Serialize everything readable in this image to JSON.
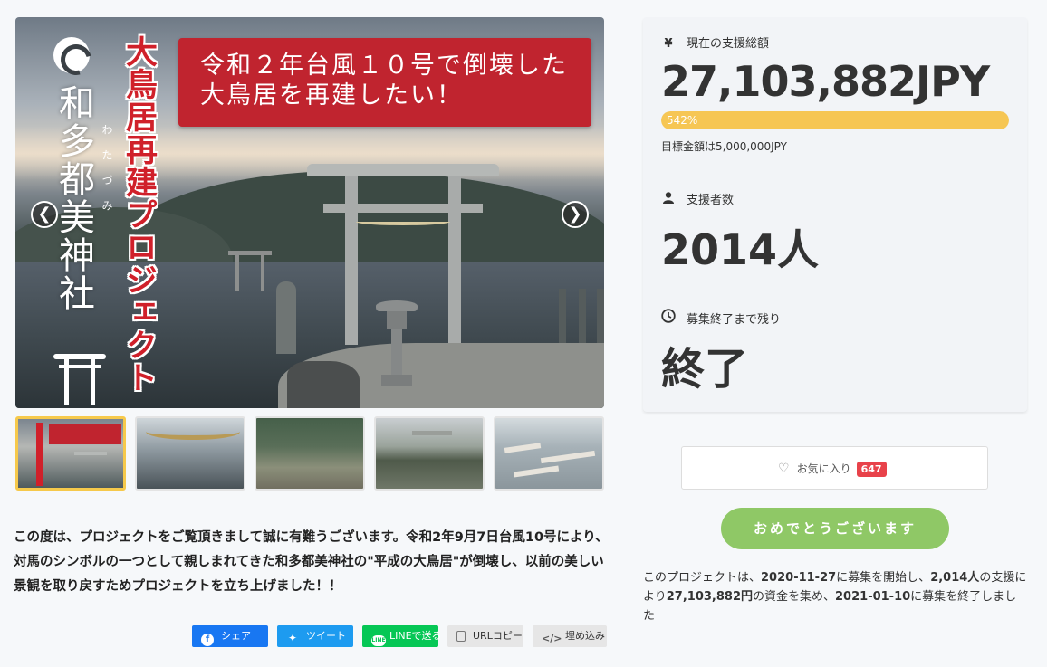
{
  "banner": {
    "line1": "令和２年台風１０号で倒壊した",
    "line2": "大鳥居を再建したい！",
    "vertical_title": "大鳥居再建プロジェクト",
    "shrine_name": "和多都美神社",
    "shrine_ruby": "わたづみ"
  },
  "carousel": {
    "prev_icon": "chevron-left-icon",
    "next_icon": "chevron-right-icon",
    "prev_glyph": "❮",
    "next_glyph": "❯",
    "thumbnail_count": 5,
    "active_index": 0
  },
  "description": "この度は、プロジェクトをご覧頂きまして誠に有難うございます。令和2年9月7日台風10号により、対馬のシンボルの一つとして親しまれてきた和多都美神社の\"平成の大鳥居\"が倒壊し、以前の美しい景観を取り戻すためプロジェクトを立ち上げました！！",
  "share": {
    "facebook": "シェア",
    "twitter": "ツイート",
    "line": "LINEで送る",
    "line_badge": "LINE",
    "urlcopy": "URLコピー",
    "embed": "埋め込み"
  },
  "stats": {
    "total_label": "現在の支援総額",
    "total_icon": "yen-icon",
    "total_glyph": "¥",
    "total_value": "27,103,882JPY",
    "progress_percent": 542,
    "progress_text": "542%",
    "goal_text": "目標金額は5,000,000JPY",
    "backers_label": "支援者数",
    "backers_icon": "person-icon",
    "backers_value": "2014人",
    "remaining_label": "募集終了まで残り",
    "remaining_icon": "clock-icon",
    "remaining_value": "終了"
  },
  "favorite": {
    "label": "お気に入り",
    "count": "647",
    "icon": "heart-icon",
    "heart_glyph": "♡"
  },
  "congrats_label": "おめでとうございます",
  "summary": {
    "p1": "このプロジェクトは、",
    "start": "2020-11-27",
    "p2": "に募集を開始し、",
    "backers": "2,014人",
    "p3": "の支援により",
    "amount": "27,103,882円",
    "p4": "の資金を集め、",
    "end": "2021-01-10",
    "p5": "に募集を終了しました"
  },
  "colors": {
    "banner_red": "#c0242f",
    "progress_yellow": "#f6c654",
    "congrats_green": "#8fc866",
    "badge_red": "#e8424a",
    "facebook_blue": "#1877f2",
    "twitter_blue": "#1d9bf0",
    "line_green": "#06c755"
  }
}
